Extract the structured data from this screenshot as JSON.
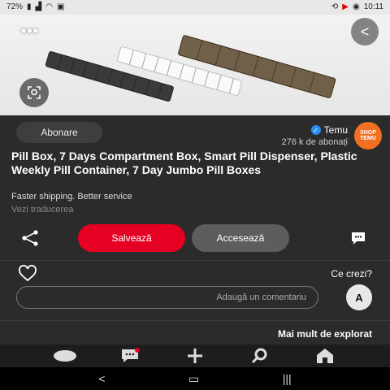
{
  "statusbar": {
    "time": "10:11",
    "battery": "72%"
  },
  "hero": {
    "more_label": "•••",
    "back_label": "<"
  },
  "channel": {
    "name": "Temu",
    "subscribers": "276 k de abonați",
    "logo_line1": "SHOP",
    "logo_line2": "TEMU",
    "follow_label": "Abonare"
  },
  "pin": {
    "title": "Pill Box, 7 Days Compartment Box, Smart Pill Dispenser, Plastic Weekly Pill Container, 7 Day Jumbo Pill Boxes",
    "subtitle": "Faster shipping. Better service",
    "translate_label": "Vezi traducerea"
  },
  "actions": {
    "save_label": "Salvează",
    "access_label": "Accesează"
  },
  "comments": {
    "question": "Ce crezi?",
    "placeholder": "Adaugă un comentariu",
    "avatar_initial": "A"
  },
  "explore": {
    "label": "Mai mult de explorat"
  },
  "colors": {
    "save_button": "#e60023",
    "access_button": "#5d5d5d",
    "verified_badge": "#2d8cf0",
    "brand_logo": "#f36f21",
    "background": "#2b2b2b"
  },
  "bottom_nav_icons": [
    "home-icon",
    "search-icon",
    "plus-icon",
    "messages-icon",
    "profile-icon"
  ],
  "system_nav_icons": [
    "recents-icon",
    "home-circle-icon",
    "back-chevron-icon"
  ]
}
